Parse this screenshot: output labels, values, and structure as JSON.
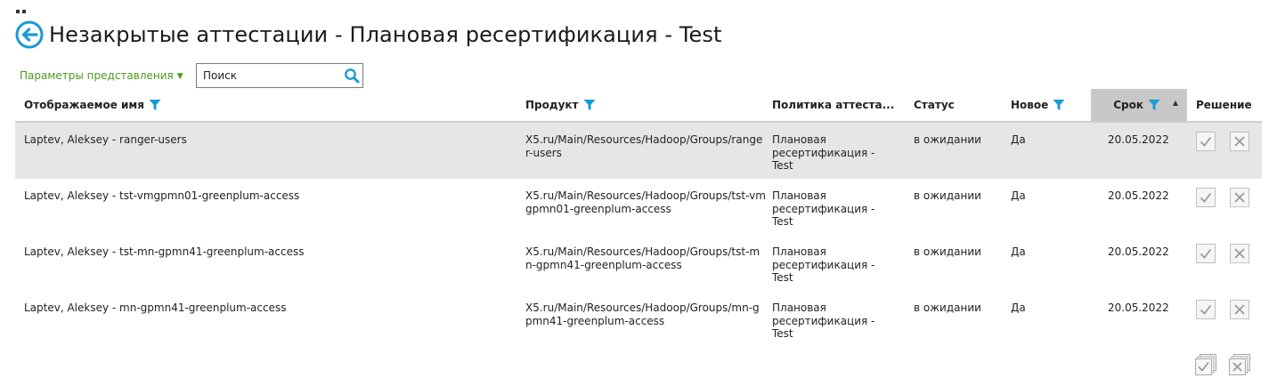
{
  "page": {
    "title": "Незакрытые аттестации - Плановая ресертификация - Test"
  },
  "toolbar": {
    "view_params_label": "Параметры представления",
    "search_placeholder": "Поиск"
  },
  "columns": {
    "display_name": "Отображаемое имя",
    "product": "Продукт",
    "policy": "Политика аттеста...",
    "status": "Статус",
    "new": "Новое",
    "due": "Срок",
    "decision": "Решение"
  },
  "rows": [
    {
      "display_name": "Laptev, Aleksey - ranger-users",
      "product": "X5.ru/Main/Resources/Hadoop/Groups/ranger-users",
      "policy": "Плановая ресертификация - Test",
      "status": "в ожидании",
      "new": "Да",
      "due": "20.05.2022"
    },
    {
      "display_name": "Laptev, Aleksey - tst-vmgpmn01-greenplum-access",
      "product": "X5.ru/Main/Resources/Hadoop/Groups/tst-vmgpmn01-greenplum-access",
      "policy": "Плановая ресертификация - Test",
      "status": "в ожидании",
      "new": "Да",
      "due": "20.05.2022"
    },
    {
      "display_name": "Laptev, Aleksey - tst-mn-gpmn41-greenplum-access",
      "product": "X5.ru/Main/Resources/Hadoop/Groups/tst-mn-gpmn41-greenplum-access",
      "policy": "Плановая ресертификация - Test",
      "status": "в ожидании",
      "new": "Да",
      "due": "20.05.2022"
    },
    {
      "display_name": "Laptev, Aleksey - mn-gpmn41-greenplum-access",
      "product": "X5.ru/Main/Resources/Hadoop/Groups/mn-gpmn41-greenplum-access",
      "policy": "Плановая ресертификация - Test",
      "status": "в ожидании",
      "new": "Да",
      "due": "20.05.2022"
    }
  ],
  "colors": {
    "accent_blue": "#1a9ad6",
    "link_green": "#4a9a1c",
    "selected_row": "#e6e6e6",
    "sorted_header": "#c8c8c8"
  }
}
